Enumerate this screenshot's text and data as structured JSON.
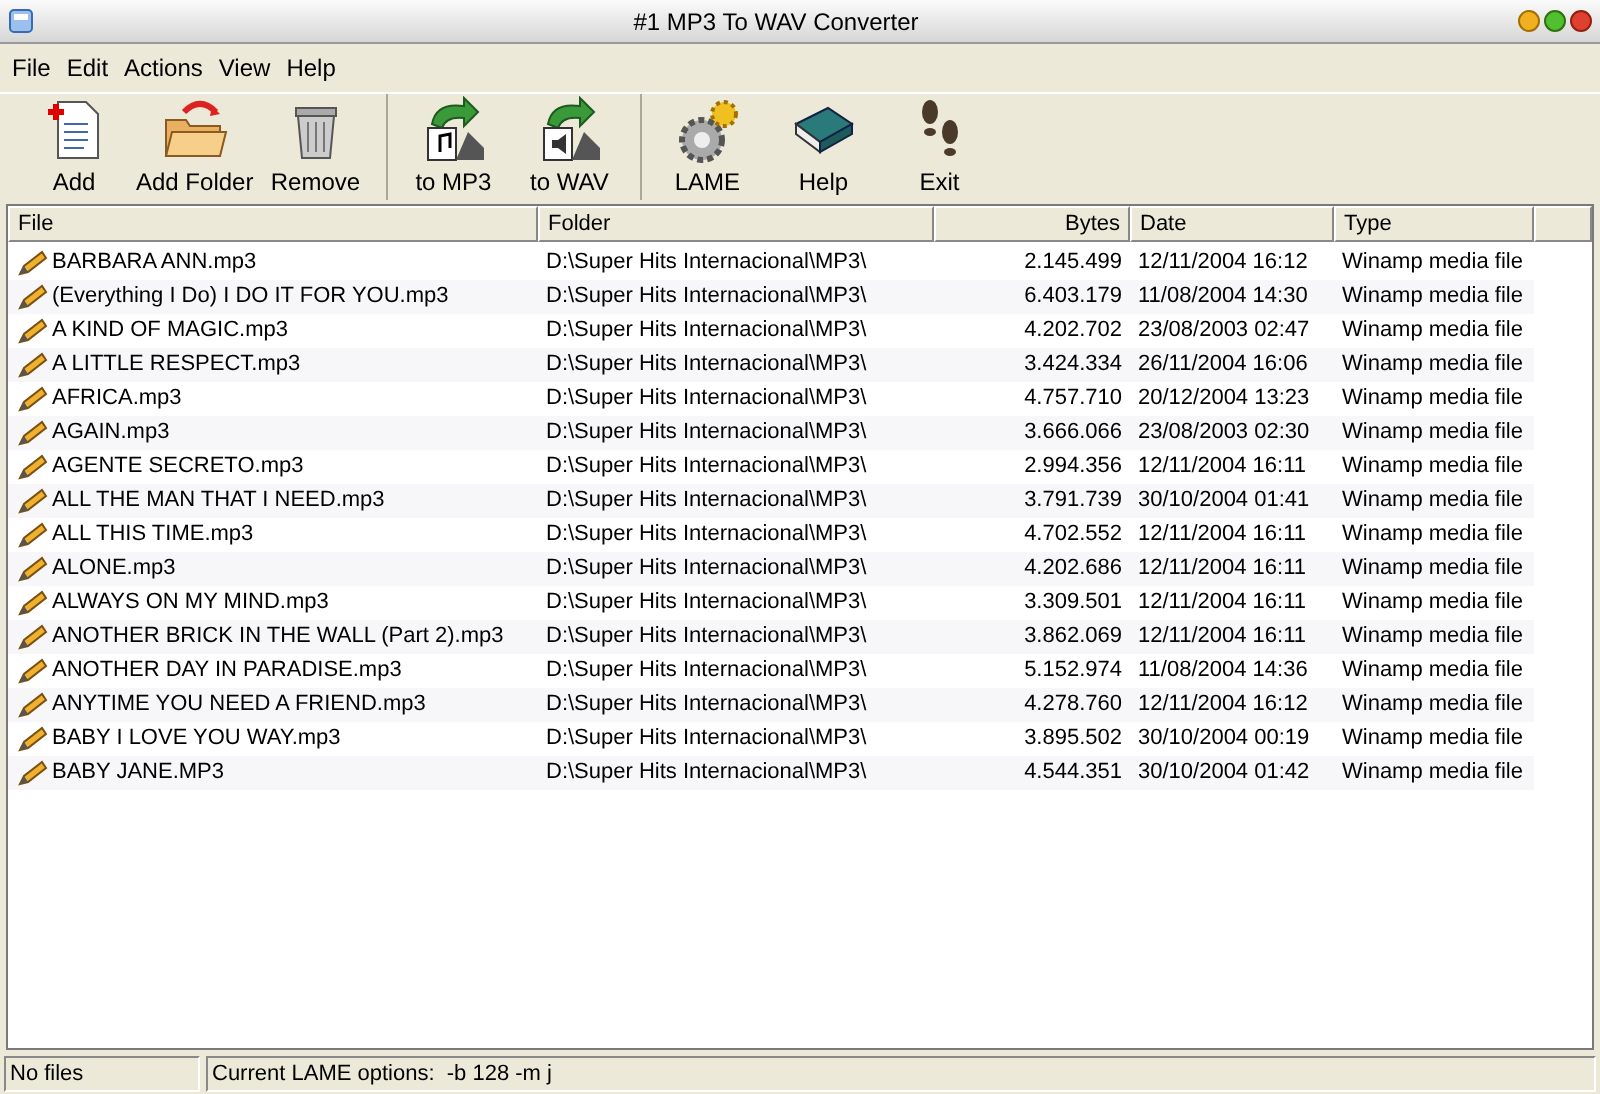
{
  "window": {
    "title": "#1 MP3 To WAV Converter"
  },
  "menu": [
    "File",
    "Edit",
    "Actions",
    "View",
    "Help"
  ],
  "toolbar": [
    [
      {
        "label": "Add",
        "kind": "add"
      },
      {
        "label": "Add Folder",
        "kind": "folder"
      },
      {
        "label": "Remove",
        "kind": "trash"
      }
    ],
    [
      {
        "label": "to MP3",
        "kind": "tomp3"
      },
      {
        "label": "to WAV",
        "kind": "towav"
      }
    ],
    [
      {
        "label": "LAME",
        "kind": "gear"
      },
      {
        "label": "Help",
        "kind": "book"
      },
      {
        "label": "Exit",
        "kind": "steps"
      }
    ]
  ],
  "table": {
    "columns": [
      "File",
      "Folder",
      "Bytes",
      "Date",
      "Type"
    ],
    "rows": [
      [
        "BARBARA ANN.mp3",
        "D:\\Super Hits Internacional\\MP3\\",
        "2.145.499",
        "12/11/2004 16:12",
        "Winamp media file"
      ],
      [
        "(Everything I Do) I DO IT FOR YOU.mp3",
        "D:\\Super Hits Internacional\\MP3\\",
        "6.403.179",
        "11/08/2004 14:30",
        "Winamp media file"
      ],
      [
        "A KIND OF MAGIC.mp3",
        "D:\\Super Hits Internacional\\MP3\\",
        "4.202.702",
        "23/08/2003 02:47",
        "Winamp media file"
      ],
      [
        "A LITTLE RESPECT.mp3",
        "D:\\Super Hits Internacional\\MP3\\",
        "3.424.334",
        "26/11/2004 16:06",
        "Winamp media file"
      ],
      [
        "AFRICA.mp3",
        "D:\\Super Hits Internacional\\MP3\\",
        "4.757.710",
        "20/12/2004 13:23",
        "Winamp media file"
      ],
      [
        "AGAIN.mp3",
        "D:\\Super Hits Internacional\\MP3\\",
        "3.666.066",
        "23/08/2003 02:30",
        "Winamp media file"
      ],
      [
        "AGENTE SECRETO.mp3",
        "D:\\Super Hits Internacional\\MP3\\",
        "2.994.356",
        "12/11/2004 16:11",
        "Winamp media file"
      ],
      [
        "ALL THE MAN THAT I NEED.mp3",
        "D:\\Super Hits Internacional\\MP3\\",
        "3.791.739",
        "30/10/2004 01:41",
        "Winamp media file"
      ],
      [
        "ALL THIS TIME.mp3",
        "D:\\Super Hits Internacional\\MP3\\",
        "4.702.552",
        "12/11/2004 16:11",
        "Winamp media file"
      ],
      [
        "ALONE.mp3",
        "D:\\Super Hits Internacional\\MP3\\",
        "4.202.686",
        "12/11/2004 16:11",
        "Winamp media file"
      ],
      [
        "ALWAYS ON MY MIND.mp3",
        "D:\\Super Hits Internacional\\MP3\\",
        "3.309.501",
        "12/11/2004 16:11",
        "Winamp media file"
      ],
      [
        "ANOTHER BRICK IN THE WALL (Part 2).mp3",
        "D:\\Super Hits Internacional\\MP3\\",
        "3.862.069",
        "12/11/2004 16:11",
        "Winamp media file"
      ],
      [
        "ANOTHER DAY IN PARADISE.mp3",
        "D:\\Super Hits Internacional\\MP3\\",
        "5.152.974",
        "11/08/2004 14:36",
        "Winamp media file"
      ],
      [
        "ANYTIME YOU NEED A FRIEND.mp3",
        "D:\\Super Hits Internacional\\MP3\\",
        "4.278.760",
        "12/11/2004 16:12",
        "Winamp media file"
      ],
      [
        "BABY I LOVE YOU WAY.mp3",
        "D:\\Super Hits Internacional\\MP3\\",
        "3.895.502",
        "30/10/2004 00:19",
        "Winamp media file"
      ],
      [
        "BABY JANE.MP3",
        "D:\\Super Hits Internacional\\MP3\\",
        "4.544.351",
        "30/10/2004 01:42",
        "Winamp media file"
      ]
    ]
  },
  "status_bar": [
    "No files",
    "Current LAME options:  -b 128 -m j"
  ]
}
